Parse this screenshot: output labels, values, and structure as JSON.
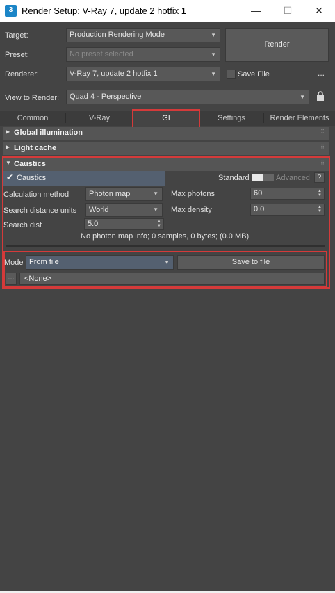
{
  "window": {
    "app_icon": "3",
    "title": "Render Setup: V-Ray 7, update 2 hotfix 1",
    "minimize_glyph": "—",
    "maximize_glyph": "☐",
    "close_glyph": "✕"
  },
  "form": {
    "target_label": "Target:",
    "target_value": "Production Rendering Mode",
    "preset_label": "Preset:",
    "preset_value": "No preset selected",
    "renderer_label": "Renderer:",
    "renderer_value": "V-Ray 7, update 2 hotfix 1",
    "save_file_label": "Save File",
    "save_file_checked": false,
    "more_label": "...",
    "view_label": "View to Render:",
    "view_value": "Quad 4 - Perspective",
    "render_button": "Render",
    "lock_icon": "lock-icon"
  },
  "tabs": [
    {
      "label": "Common",
      "active": false
    },
    {
      "label": "V-Ray",
      "active": false
    },
    {
      "label": "GI",
      "active": true
    },
    {
      "label": "Settings",
      "active": false
    },
    {
      "label": "Render Elements",
      "active": false
    }
  ],
  "rollouts": {
    "global_illumination": "Global illumination",
    "light_cache": "Light cache",
    "caustics": "Caustics",
    "grip": "⠿"
  },
  "caustics": {
    "enable_label": "Caustics",
    "enabled": true,
    "standard_label": "Standard",
    "advanced_label": "Advanced",
    "help_label": "?",
    "calc_method_label": "Calculation method",
    "calc_method_value": "Photon map",
    "search_units_label": "Search distance units",
    "search_units_value": "World",
    "search_dist_label": "Search dist",
    "search_dist_value": "5.0",
    "max_photons_label": "Max photons",
    "max_photons_value": "60",
    "max_density_label": "Max density",
    "max_density_value": "0.0",
    "info": "No photon map info; 0 samples, 0 bytes; (0.0 MB)",
    "mode_label": "Mode",
    "mode_value": "From file",
    "save_to_file": "Save to file",
    "browse_label": "...",
    "file_value": "<None>"
  },
  "colors": {
    "highlight_red": "#d43a3a",
    "selected_blue": "#546070",
    "panel_bg": "#444444"
  }
}
